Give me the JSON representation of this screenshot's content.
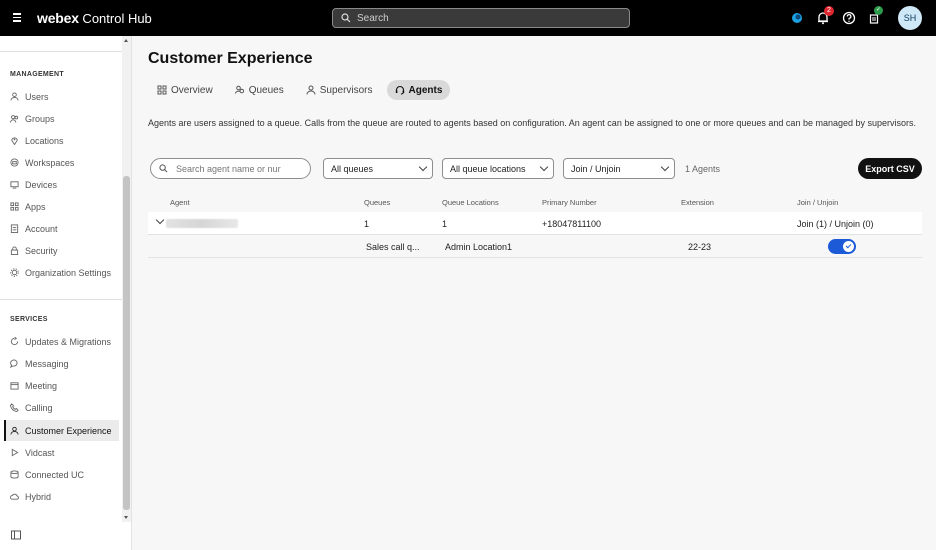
{
  "header": {
    "brand_bold": "webex",
    "brand_rest": " Control Hub",
    "search_placeholder": "Search",
    "notifications_count": "2",
    "avatar_initials": "SH",
    "icons": [
      "menu-icon",
      "search-icon",
      "webex-app-icon",
      "bell-icon",
      "help-icon",
      "tasks-icon"
    ]
  },
  "sidebar": {
    "management_label": "MANAGEMENT",
    "management_items": [
      {
        "label": "Users",
        "icon": "user-icon"
      },
      {
        "label": "Groups",
        "icon": "group-icon"
      },
      {
        "label": "Locations",
        "icon": "location-icon"
      },
      {
        "label": "Workspaces",
        "icon": "workspace-icon"
      },
      {
        "label": "Devices",
        "icon": "device-icon"
      },
      {
        "label": "Apps",
        "icon": "apps-icon"
      },
      {
        "label": "Account",
        "icon": "account-icon"
      },
      {
        "label": "Security",
        "icon": "lock-icon"
      },
      {
        "label": "Organization Settings",
        "icon": "gear-icon"
      }
    ],
    "services_label": "SERVICES",
    "services_items": [
      {
        "label": "Updates & Migrations",
        "icon": "refresh-icon"
      },
      {
        "label": "Messaging",
        "icon": "message-icon"
      },
      {
        "label": "Meeting",
        "icon": "calendar-icon"
      },
      {
        "label": "Calling",
        "icon": "phone-icon"
      },
      {
        "label": "Customer Experience",
        "icon": "customer-icon",
        "active": true
      },
      {
        "label": "Vidcast",
        "icon": "play-icon"
      },
      {
        "label": "Connected UC",
        "icon": "stack-icon"
      },
      {
        "label": "Hybrid",
        "icon": "cloud-icon"
      }
    ]
  },
  "main": {
    "title": "Customer Experience",
    "tabs": [
      {
        "label": "Overview",
        "icon": "grid-icon"
      },
      {
        "label": "Queues",
        "icon": "queue-icon"
      },
      {
        "label": "Supervisors",
        "icon": "supervisor-icon"
      },
      {
        "label": "Agents",
        "icon": "headset-icon",
        "active": true
      }
    ],
    "description": "Agents are users assigned to a queue. Calls from the queue are routed to agents based on configuration. An agent can be assigned to one or more queues and can be managed by supervisors.",
    "filters": {
      "search_placeholder": "Search agent name or nur",
      "queues": "All queues",
      "locations": "All queue locations",
      "join": "Join / Unjoin",
      "count": "1 Agents"
    },
    "export_label": "Export CSV",
    "columns": [
      "Agent",
      "Queues",
      "Queue Locations",
      "Primary Number",
      "Extension",
      "Join / Unjoin"
    ],
    "agent_row": {
      "queues": "1",
      "locations": "1",
      "primary_number": "+18047811100",
      "extension": "",
      "join_status": "Join (1) / Unjoin (0)"
    },
    "queue_row": {
      "queue": "Sales call q...",
      "location": "Admin Location1",
      "extension": "22-23",
      "joined": true
    }
  }
}
